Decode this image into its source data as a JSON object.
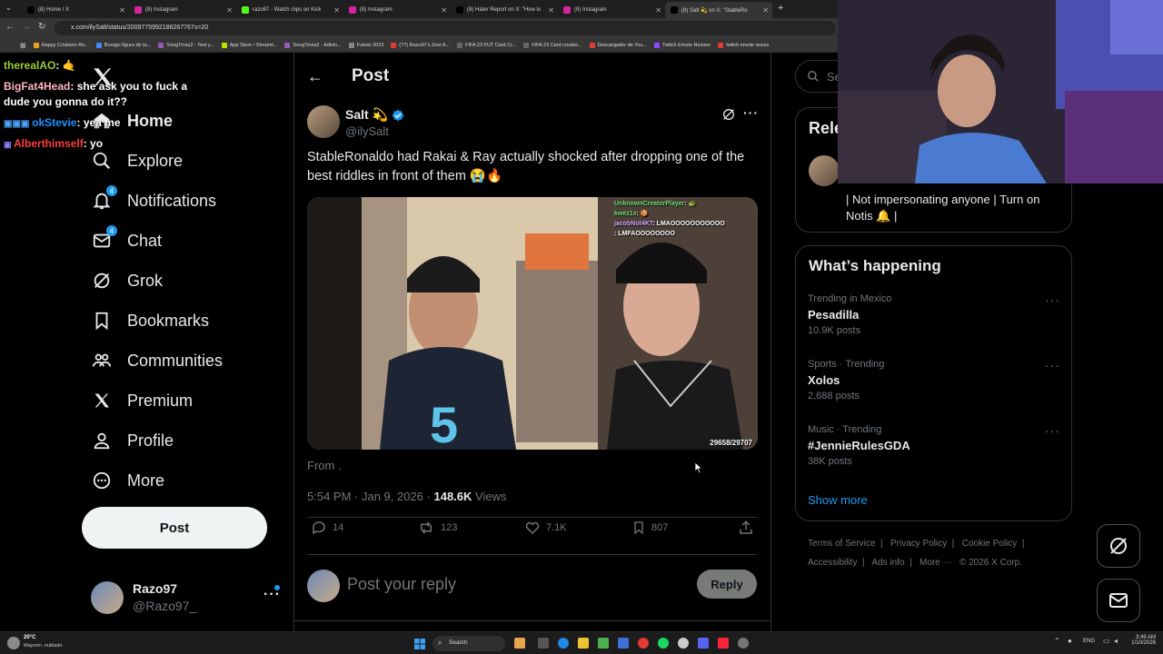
{
  "browser": {
    "tabs": [
      {
        "title": "(8) Home / X",
        "color": "#000000"
      },
      {
        "title": "(8) Instagram",
        "color": "#d6249f"
      },
      {
        "title": "razo97 - Watch clips on Kick",
        "color": "#53fc18"
      },
      {
        "title": "(8) Instagram",
        "color": "#d6249f"
      },
      {
        "title": "(8) Hater Report on X: \"How lo",
        "color": "#000000"
      },
      {
        "title": "(8) Instagram",
        "color": "#d6249f"
      },
      {
        "title": "(8) Salt 💫 on X: \"StableRo",
        "color": "#000000"
      }
    ],
    "url": "x.com/ilySalt/status/2009775992186267767s=20",
    "bookmarks": [
      "Happy Cristiano Ro...",
      "Burago figura de to...",
      "SongTrivia2 - Test y...",
      "App Store / Streami...",
      "SongTrivia2 - Adivin...",
      "Futwiz 2023",
      "(77) Razo97's Zest A...",
      "FIFA 23 FUT Card Cr...",
      "FIFA 23 Card creator...",
      "Descargador de You...",
      "Twitch Emote Resizer",
      "twitch emote resize"
    ]
  },
  "chat_overlay": [
    {
      "user": "therealAO",
      "msg": ": 🤙",
      "color": "#9acd32"
    },
    {
      "user": "BigFat4Head",
      "msg": ": she ask you to fuck a dude you gonna do it??",
      "color": "#ffb6c1"
    },
    {
      "user": "okStevie",
      "msg": ": yea me",
      "color": "#1e90ff"
    },
    {
      "user": "Alberthimself",
      "msg": ": yo",
      "color": "#ff3b3b"
    }
  ],
  "sidebar": {
    "items": [
      {
        "label": "Home"
      },
      {
        "label": "Explore"
      },
      {
        "label": "Notifications",
        "badge": "4"
      },
      {
        "label": "Chat",
        "badge": "4"
      },
      {
        "label": "Grok"
      },
      {
        "label": "Bookmarks"
      },
      {
        "label": "Communities"
      },
      {
        "label": "Premium"
      },
      {
        "label": "Profile"
      },
      {
        "label": "More"
      }
    ],
    "post_button": "Post",
    "account": {
      "name": "Razo97",
      "handle": "@Razo97_"
    }
  },
  "post": {
    "header": "Post",
    "author_name": "Salt 💫",
    "author_handle": "@ilySalt",
    "text": "StableRonaldo had Rakai & Ray actually shocked after dropping one of the best riddles in front of them 😭🔥",
    "media_chat": [
      {
        "user": "UnknownCreatorPlayer",
        "msg": ": 🐢"
      },
      {
        "user": "kwez1x",
        "msg": ": 🍪"
      },
      {
        "user": "jacobNot4KT",
        "msg": ": LMAOOOOOOOOOOO"
      },
      {
        "user": "",
        "msg": ": LMFAOOOOOOOO"
      }
    ],
    "media_counter": "29658/29707",
    "from": "From .",
    "time": "5:54 PM · Jan 9, 2026 ·",
    "views_count": "148.6K",
    "views_label": "Views",
    "replies": "14",
    "reposts": "123",
    "likes": "7.1K",
    "bookmarks": "807",
    "reply_placeholder": "Post your reply",
    "reply_button": "Reply"
  },
  "right": {
    "search_placeholder": "Search",
    "relevant_title": "Relevant people",
    "relevant_bio": "| Not impersonating anyone | Turn on Notis 🔔 |",
    "happening_title": "What’s happening",
    "trends": [
      {
        "category": "Trending in Mexico",
        "name": "Pesadilla",
        "count": "10.9K posts"
      },
      {
        "category": "Sports · Trending",
        "name": "Xolos",
        "count": "2,688 posts"
      },
      {
        "category": "Music · Trending",
        "name": "#JennieRulesGDA",
        "count": "38K posts"
      }
    ],
    "show_more": "Show more",
    "footer": [
      "Terms of Service",
      "Privacy Policy",
      "Cookie Policy",
      "Accessibility",
      "Ads info",
      "More ···",
      "© 2026 X Corp."
    ]
  },
  "taskbar": {
    "weather_temp": "20°C",
    "weather_desc": "Mayorm. nublado",
    "search": "Search",
    "lang": "ENG",
    "time": "3:49 AM",
    "date": "1/10/2026"
  }
}
